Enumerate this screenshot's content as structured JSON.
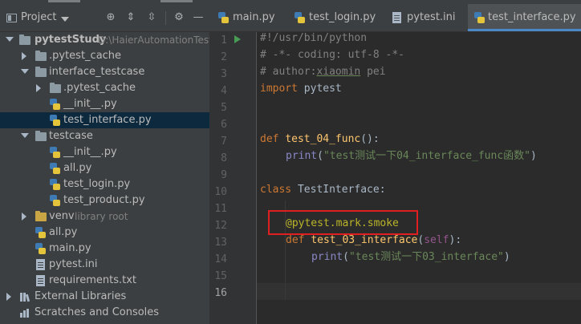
{
  "project_panel": {
    "title": "Project",
    "tree": [
      {
        "label": "pytestStudy",
        "hint": "D:\\HaierAutomationTest",
        "kind": "folder",
        "expanded": true,
        "bold": true
      },
      {
        "label": ".pytest_cache",
        "kind": "folder",
        "expanded": false
      },
      {
        "label": "interface_testcase",
        "kind": "folder",
        "expanded": true
      },
      {
        "label": ".pytest_cache",
        "kind": "folder",
        "expanded": false
      },
      {
        "label": "__init__.py",
        "kind": "py"
      },
      {
        "label": "test_interface.py",
        "kind": "py",
        "selected": true
      },
      {
        "label": "testcase",
        "kind": "folder",
        "expanded": true
      },
      {
        "label": "__init__.py",
        "kind": "py"
      },
      {
        "label": "all.py",
        "kind": "py"
      },
      {
        "label": "test_login.py",
        "kind": "py"
      },
      {
        "label": "test_product.py",
        "kind": "py"
      },
      {
        "label": "venv",
        "hint": "library root",
        "kind": "folder-excluded",
        "expanded": false
      },
      {
        "label": "all.py",
        "kind": "py"
      },
      {
        "label": "main.py",
        "kind": "py"
      },
      {
        "label": "pytest.ini",
        "kind": "ini"
      },
      {
        "label": "requirements.txt",
        "kind": "txt"
      },
      {
        "label": "External Libraries",
        "kind": "ext",
        "expanded": false
      },
      {
        "label": "Scratches and Consoles",
        "kind": "scratch"
      }
    ]
  },
  "editor": {
    "tabs": [
      {
        "label": "main.py",
        "kind": "py",
        "active": false
      },
      {
        "label": "test_login.py",
        "kind": "py",
        "active": false
      },
      {
        "label": "pytest.ini",
        "kind": "ini",
        "active": false
      },
      {
        "label": "test_interface.py",
        "kind": "py",
        "active": true
      }
    ],
    "close_glyph": "×",
    "current_line": 16,
    "line_numbers": [
      "1",
      "2",
      "3",
      "4",
      "5",
      "6",
      "7",
      "8",
      "9",
      "10",
      "11",
      "12",
      "13",
      "14",
      "15",
      "16"
    ],
    "code": {
      "l1": "#!/usr/bin/python",
      "l2": "# -*- coding: utf-8 -*-",
      "l3a": "# author:",
      "l3b": "xiaomin",
      "l3c": " pei",
      "l4a": "import",
      "l4b": " pytest",
      "l7a": "def",
      "l7b": "test_04_func",
      "l7c": "():",
      "l8a": "print",
      "l8b": "(",
      "l8c": "\"test测试一下04_interface_func函数\"",
      "l8d": ")",
      "l10a": "class",
      "l10b": " TestInterface:",
      "l12": "@pytest.mark.smoke",
      "l13a": "def",
      "l13b": "test_03_interface",
      "l13c": "(",
      "l13d": "self",
      "l13e": "):",
      "l14a": "print",
      "l14b": "(",
      "l14c": "\"test测试一下03_interface\"",
      "l14d": ")"
    }
  },
  "colors": {
    "highlight_box": "#e02020",
    "selection": "#0d293e",
    "accent": "#4a88c7"
  }
}
